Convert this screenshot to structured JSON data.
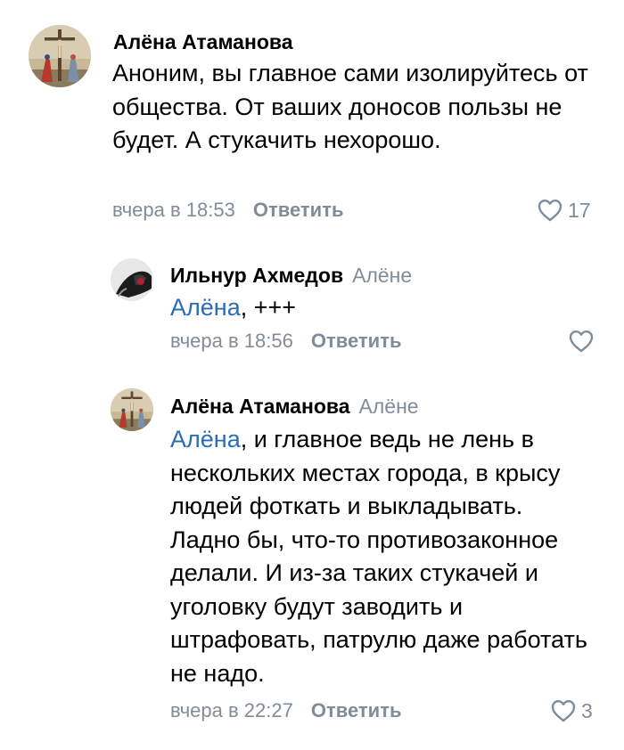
{
  "comments": [
    {
      "author": "Алёна Атаманова",
      "reply_to": "",
      "mention": "",
      "text": "Аноним, вы главное сами изолируйтесь от общества. От ваших доносов пользы не будет. А стукачить нехорошо.",
      "time": "вчера в 18:53",
      "reply_label": "Ответить",
      "likes": "17",
      "avatar_icon": "crucifixion-icon"
    },
    {
      "author": "Ильнур Ахмедов",
      "reply_to": "Алёне",
      "mention": "Алёна",
      "text": ", +++",
      "time": "вчера в 18:56",
      "reply_label": "Ответить",
      "likes": "",
      "avatar_icon": "user-photo-icon"
    },
    {
      "author": "Алёна Атаманова",
      "reply_to": "Алёне",
      "mention": "Алёна",
      "text": ", и главное ведь не лень в нескольких местах города, в крысу людей фоткать и выкладывать. Ладно бы, что-то противозаконное делали. И из-за таких стукачей и уголовку будут заводить и штрафовать, патрулю даже работать не надо.",
      "time": "вчера в 22:27",
      "reply_label": "Ответить",
      "likes": "3",
      "avatar_icon": "crucifixion-icon"
    }
  ],
  "colors": {
    "secondary": "#818c99",
    "mention": "#2a6db4",
    "text": "#000000"
  }
}
